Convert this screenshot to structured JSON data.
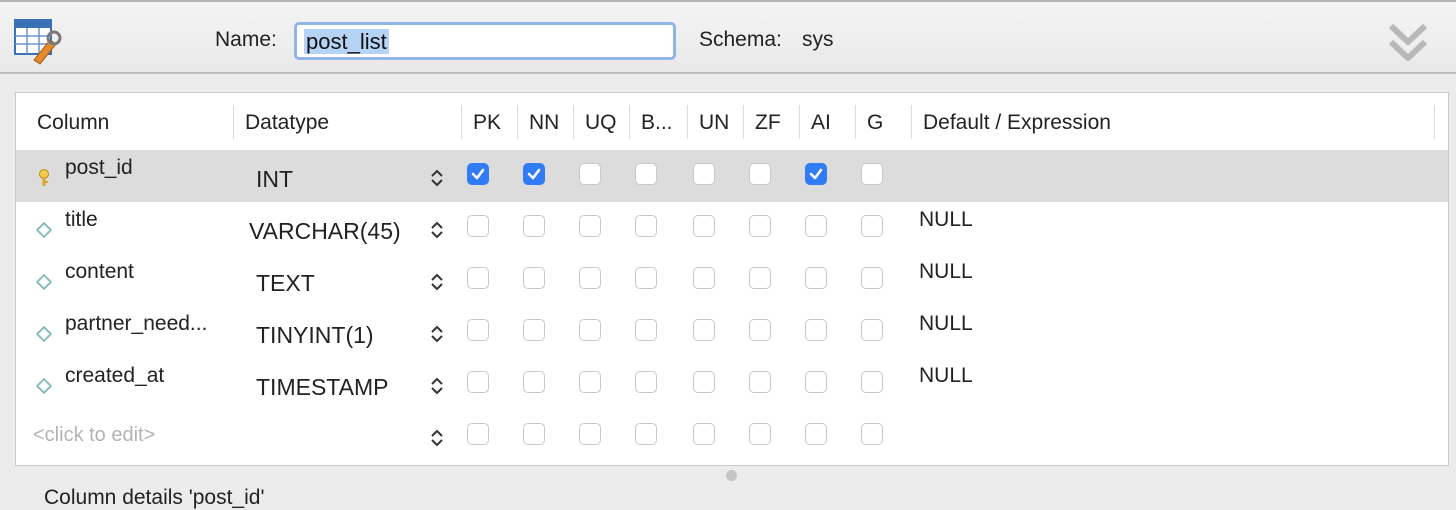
{
  "toolbar": {
    "name_label": "Name:",
    "name_value": "post_list",
    "schema_label": "Schema:",
    "schema_value": "sys",
    "table_icon": "table-edit-icon",
    "collapse_icon": "double-chevron-down-icon"
  },
  "grid": {
    "headers": [
      "Column",
      "Datatype",
      "PK",
      "NN",
      "UQ",
      "B...",
      "UN",
      "ZF",
      "AI",
      "G",
      "Default / Expression"
    ],
    "rows": [
      {
        "name": "post_id",
        "datatype": "INT",
        "flags": [
          true,
          true,
          false,
          false,
          false,
          false,
          true,
          false
        ],
        "default": "",
        "key": true,
        "selected": true
      },
      {
        "name": "title",
        "datatype": "VARCHAR(45)",
        "flags": [
          false,
          false,
          false,
          false,
          false,
          false,
          false,
          false
        ],
        "default": "NULL",
        "key": false,
        "selected": false
      },
      {
        "name": "content",
        "datatype": "TEXT",
        "flags": [
          false,
          false,
          false,
          false,
          false,
          false,
          false,
          false
        ],
        "default": "NULL",
        "key": false,
        "selected": false
      },
      {
        "name": "partner_need...",
        "datatype": "TINYINT(1)",
        "flags": [
          false,
          false,
          false,
          false,
          false,
          false,
          false,
          false
        ],
        "default": "NULL",
        "key": false,
        "selected": false
      },
      {
        "name": "created_at",
        "datatype": "TIMESTAMP",
        "flags": [
          false,
          false,
          false,
          false,
          false,
          false,
          false,
          false
        ],
        "default": "NULL",
        "key": false,
        "selected": false
      }
    ],
    "new_row_placeholder": "<click to edit>"
  },
  "details": {
    "label": "Column details 'post_id'"
  },
  "colors": {
    "accent": "#2f7cf6",
    "selected_row": "#dcdcdc",
    "input_focus": "#8fb4e8"
  }
}
